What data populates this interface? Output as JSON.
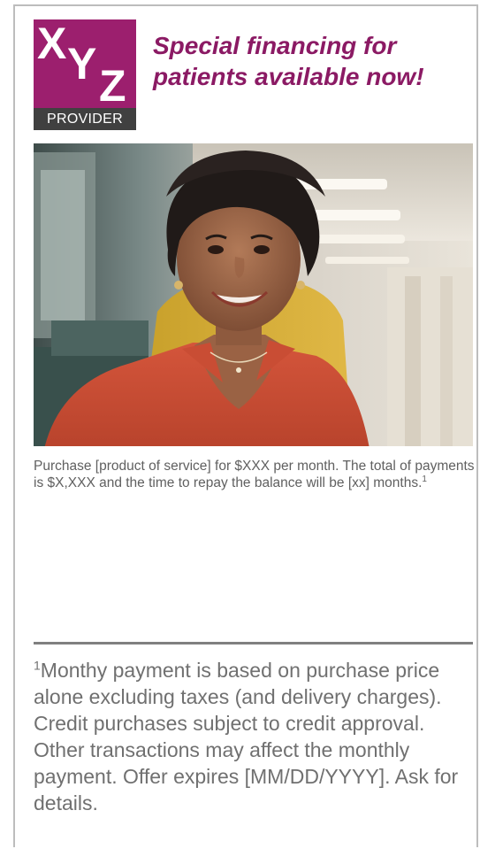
{
  "logo": {
    "letters": [
      "X",
      "Y",
      "Z"
    ],
    "band_text": "PROVIDER",
    "brand_color": "#9c1f6e"
  },
  "headline": {
    "line1": "Special financing for",
    "line2": "patients available now!",
    "color": "#8b1a64"
  },
  "photo": {
    "subject": "smiling-woman-photo"
  },
  "caption": {
    "text": "Purchase [product of service] for $XXX per month. The total of payments is $X,XXX and the time to repay the balance will be [xx] months.",
    "footnote_marker": "1"
  },
  "footnote": {
    "marker": "1",
    "text": "Monthy payment is based on purchase price alone excluding taxes (and delivery charges). Credit purchases subject to credit approval. Other transactions may affect the monthly payment. Offer expires [MM/DD/YYYY]. Ask for details."
  }
}
